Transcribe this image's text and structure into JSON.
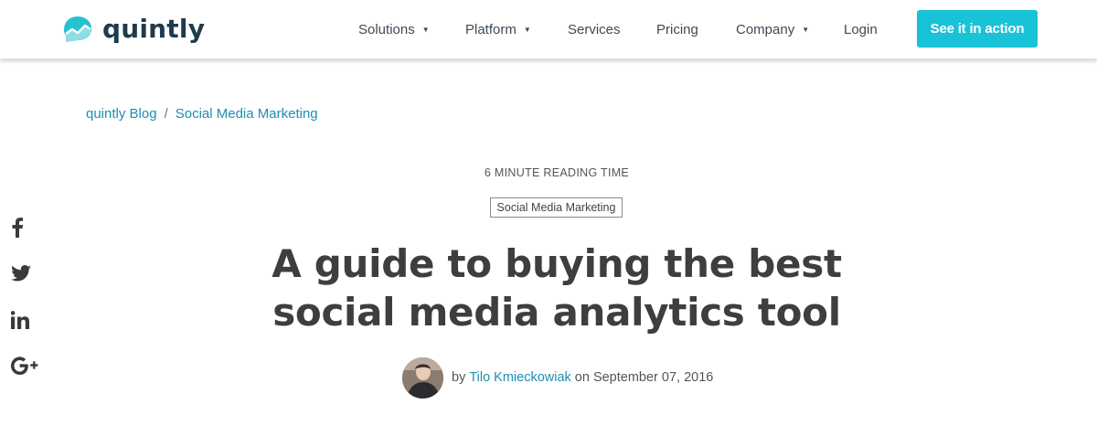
{
  "header": {
    "logo_text": "quintly",
    "nav": [
      {
        "label": "Solutions",
        "has_dropdown": true
      },
      {
        "label": "Platform",
        "has_dropdown": true
      },
      {
        "label": "Services",
        "has_dropdown": false
      },
      {
        "label": "Pricing",
        "has_dropdown": false
      },
      {
        "label": "Company",
        "has_dropdown": true
      },
      {
        "label": "Login",
        "has_dropdown": false
      }
    ],
    "cta_label": "See it in action",
    "caret": "▼"
  },
  "breadcrumb": {
    "items": [
      "quintly Blog",
      "Social Media Marketing"
    ],
    "separator": "/"
  },
  "social": {
    "icons": [
      "facebook-icon",
      "twitter-icon",
      "linkedin-icon",
      "google-plus-icon"
    ]
  },
  "article": {
    "reading_time": "6 MINUTE READING TIME",
    "tag": "Social Media Marketing",
    "title_line1": "A guide to buying the best",
    "title_line2": "social media analytics tool",
    "byline_prefix": "by",
    "author": "Tilo Kmieckowiak",
    "byline_middle": "on",
    "date": "September 07, 2016"
  },
  "colors": {
    "accent": "#19c2d6",
    "link": "#1e8fb0",
    "logo_text": "#1f3b4d",
    "title": "#3e3e3e"
  }
}
